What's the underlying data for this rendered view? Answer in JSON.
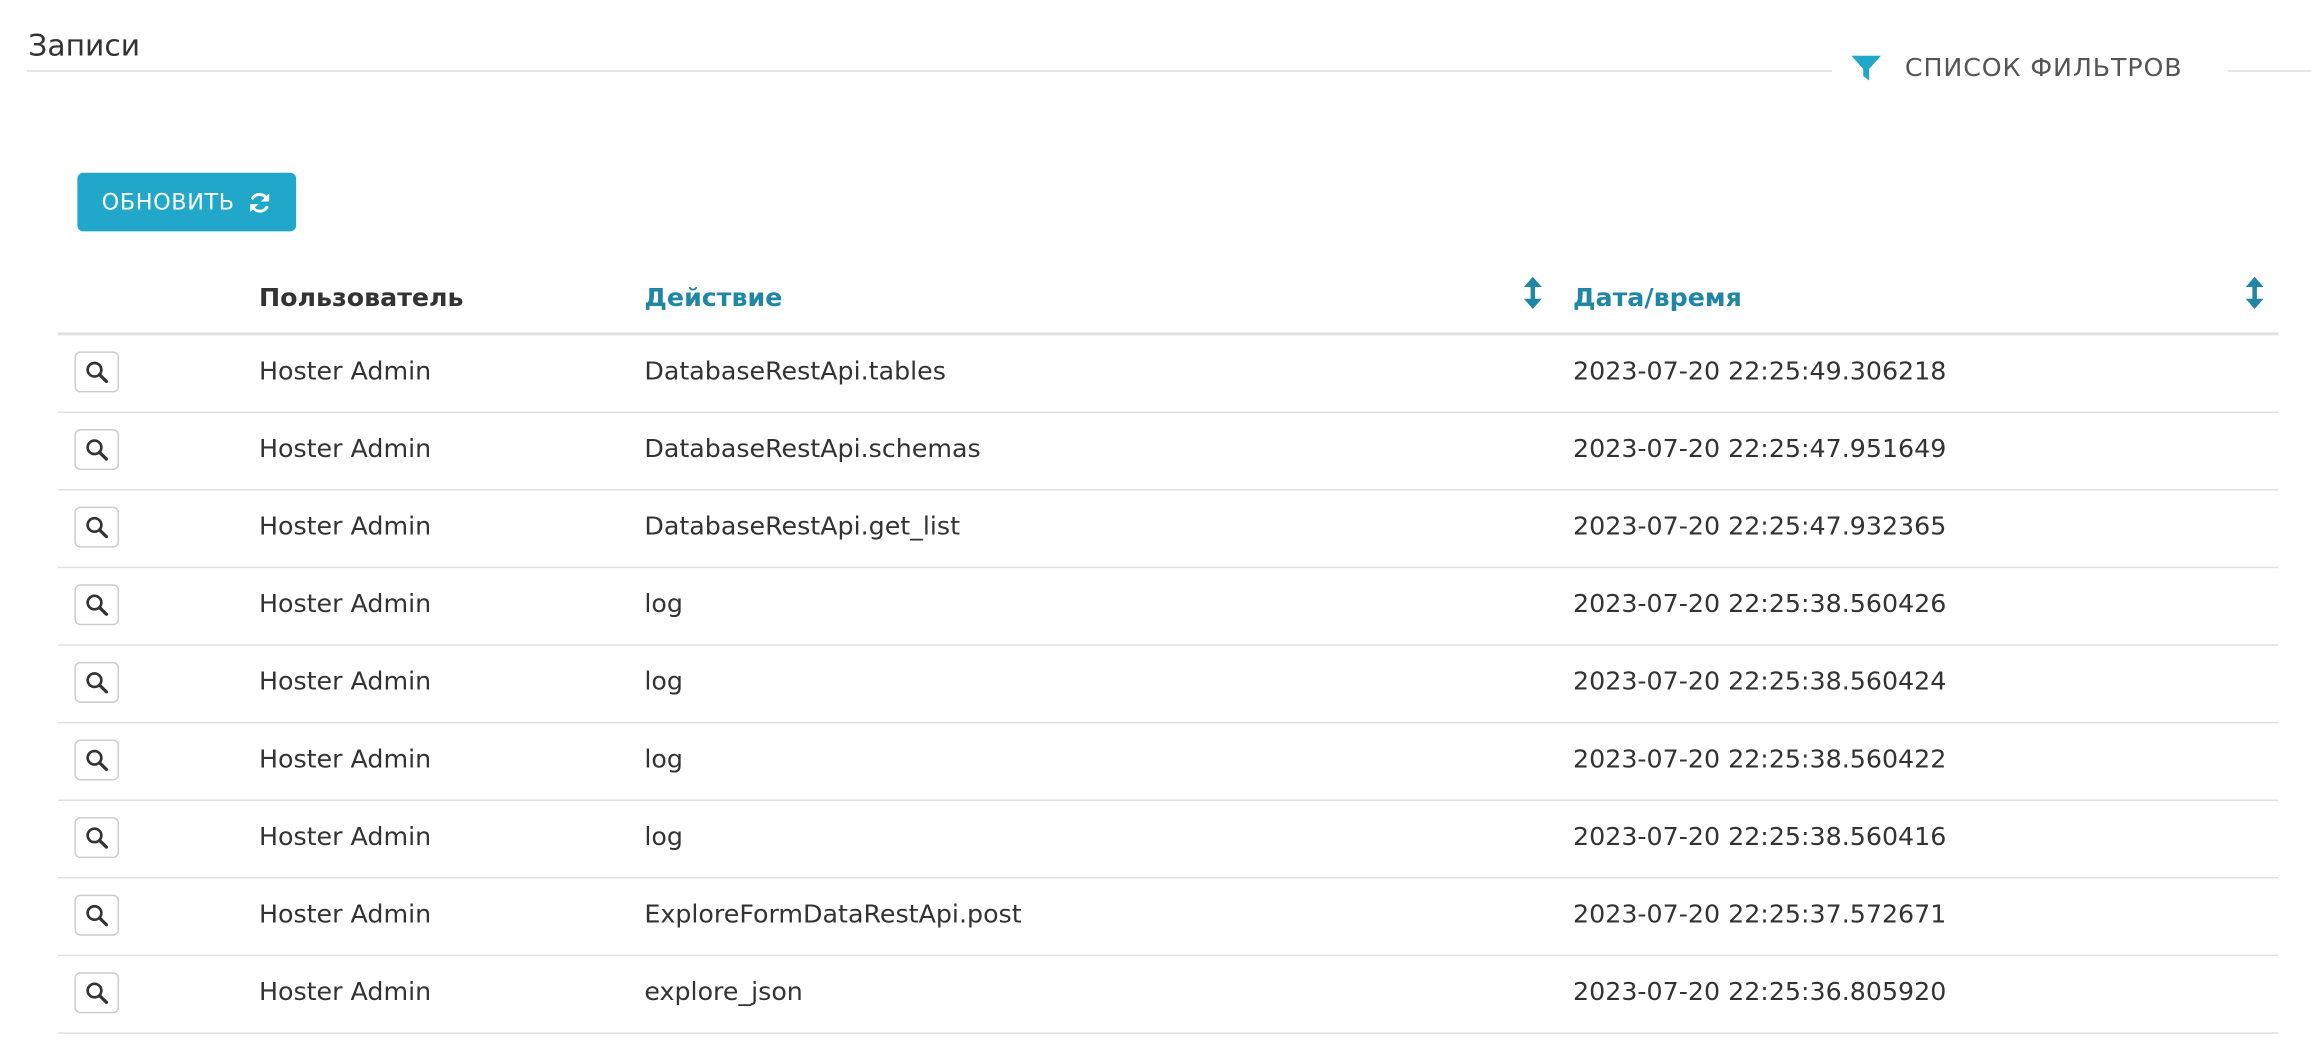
{
  "page": {
    "title": "Записи",
    "filters_label": "СПИСОК ФИЛЬТРОВ"
  },
  "toolbar": {
    "refresh_label": "ОБНОВИТЬ"
  },
  "table": {
    "columns": {
      "user": "Пользователь",
      "action": "Действие",
      "datetime": "Дата/время"
    },
    "rows": [
      {
        "user": "Hoster Admin",
        "action": "DatabaseRestApi.tables",
        "datetime": "2023-07-20 22:25:49.306218"
      },
      {
        "user": "Hoster Admin",
        "action": "DatabaseRestApi.schemas",
        "datetime": "2023-07-20 22:25:47.951649"
      },
      {
        "user": "Hoster Admin",
        "action": "DatabaseRestApi.get_list",
        "datetime": "2023-07-20 22:25:47.932365"
      },
      {
        "user": "Hoster Admin",
        "action": "log",
        "datetime": "2023-07-20 22:25:38.560426"
      },
      {
        "user": "Hoster Admin",
        "action": "log",
        "datetime": "2023-07-20 22:25:38.560424"
      },
      {
        "user": "Hoster Admin",
        "action": "log",
        "datetime": "2023-07-20 22:25:38.560422"
      },
      {
        "user": "Hoster Admin",
        "action": "log",
        "datetime": "2023-07-20 22:25:38.560416"
      },
      {
        "user": "Hoster Admin",
        "action": "ExploreFormDataRestApi.post",
        "datetime": "2023-07-20 22:25:37.572671"
      },
      {
        "user": "Hoster Admin",
        "action": "explore_json",
        "datetime": "2023-07-20 22:25:36.805920"
      }
    ]
  },
  "icons": {
    "filter": "filter-icon",
    "refresh": "refresh-icon",
    "sort": "sort-icon",
    "view": "search-icon"
  },
  "colors": {
    "accent": "#20a7c9",
    "link": "#1f86a5",
    "text": "#333333",
    "divider": "#e0e0e0"
  }
}
